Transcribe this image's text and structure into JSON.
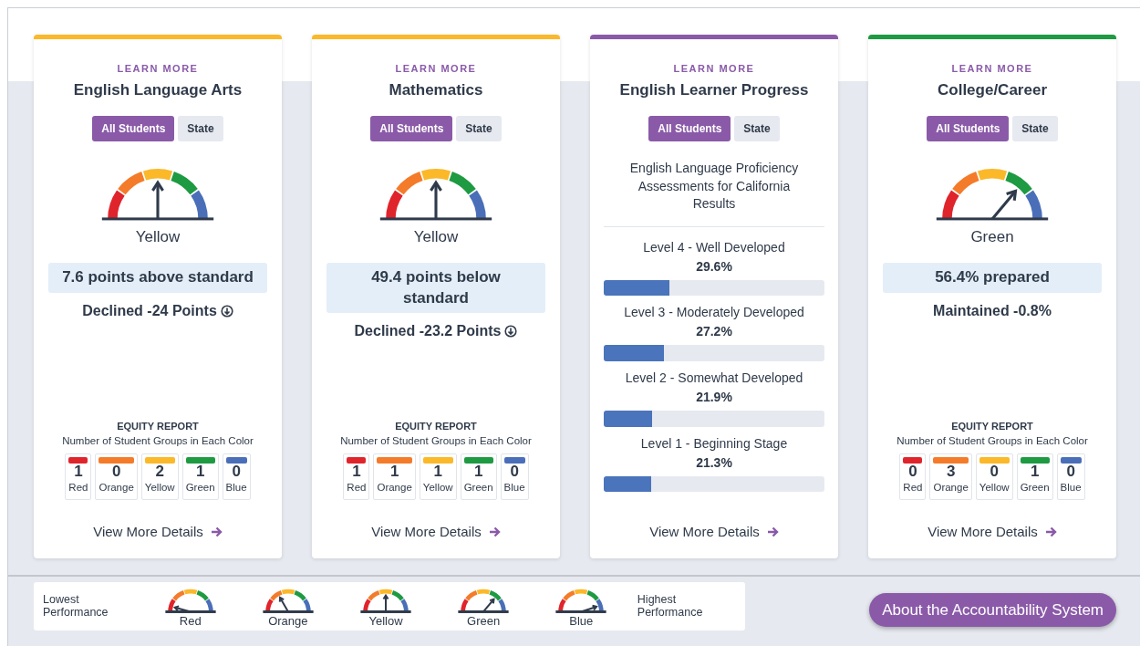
{
  "cards": [
    {
      "color": "#fbb829",
      "link": "LEARN MORE",
      "title": "English Language Arts",
      "toggles": [
        {
          "label": "All Students",
          "selected": true
        },
        {
          "label": "State",
          "selected": false
        }
      ],
      "gauge": {
        "kind": "yellow"
      },
      "status": "Yellow",
      "highlight": "7.6 points above standard",
      "change": "Declined -24 Points",
      "declined_icon": true,
      "equity": {
        "title": "EQUITY REPORT",
        "subtitle": "Number of Student Groups in Each Color",
        "groups": [
          {
            "color": "#e0242b",
            "count": "1",
            "label": "Red"
          },
          {
            "color": "#f47b2a",
            "count": "0",
            "label": "Orange"
          },
          {
            "color": "#fbb829",
            "count": "2",
            "label": "Yellow"
          },
          {
            "color": "#1e9a42",
            "count": "1",
            "label": "Green"
          },
          {
            "color": "#4a6fb8",
            "count": "0",
            "label": "Blue"
          }
        ]
      },
      "details": "View More Details"
    },
    {
      "color": "#fbb829",
      "link": "LEARN MORE",
      "title": "Mathematics",
      "toggles": [
        {
          "label": "All Students",
          "selected": true
        },
        {
          "label": "State",
          "selected": false
        }
      ],
      "gauge": {
        "kind": "yellow"
      },
      "status": "Yellow",
      "highlight": "49.4 points below standard",
      "change": "Declined -23.2 Points",
      "declined_icon": true,
      "equity": {
        "title": "EQUITY REPORT",
        "subtitle": "Number of Student Groups in Each Color",
        "groups": [
          {
            "color": "#e0242b",
            "count": "1",
            "label": "Red"
          },
          {
            "color": "#f47b2a",
            "count": "1",
            "label": "Orange"
          },
          {
            "color": "#fbb829",
            "count": "1",
            "label": "Yellow"
          },
          {
            "color": "#1e9a42",
            "count": "1",
            "label": "Green"
          },
          {
            "color": "#4a6fb8",
            "count": "0",
            "label": "Blue"
          }
        ]
      },
      "details": "View More Details"
    },
    {
      "color": "#8a5aa8",
      "link": "LEARN MORE",
      "title": "English Learner Progress",
      "toggles": [
        {
          "label": "All Students",
          "selected": true
        },
        {
          "label": "State",
          "selected": false
        }
      ],
      "description": "English Language Proficiency Assessments for California Results",
      "levels": [
        {
          "label": "Level 4 - Well Developed",
          "value": "29.6%",
          "level": 0.296
        },
        {
          "label": "Level 3 - Moderately Developed",
          "value": "27.2%",
          "level": 0.272
        },
        {
          "label": "Level 2 - Somewhat Developed",
          "value": "21.9%",
          "level": 0.219
        },
        {
          "label": "Level 1 - Beginning Stage",
          "value": "21.3%",
          "level": 0.213
        }
      ],
      "details": "View More Details"
    },
    {
      "color": "#1e9a42",
      "link": "LEARN MORE",
      "title": "College/Career",
      "toggles": [
        {
          "label": "All Students",
          "selected": true
        },
        {
          "label": "State",
          "selected": false
        }
      ],
      "gauge": {
        "kind": "green"
      },
      "status": "Green",
      "highlight": "56.4% prepared",
      "change": "Maintained -0.8%",
      "equity": {
        "title": "EQUITY REPORT",
        "subtitle": "Number of Student Groups in Each Color",
        "groups": [
          {
            "color": "#e0242b",
            "count": "0",
            "label": "Red"
          },
          {
            "color": "#f47b2a",
            "count": "3",
            "label": "Orange"
          },
          {
            "color": "#fbb829",
            "count": "0",
            "label": "Yellow"
          },
          {
            "color": "#1e9a42",
            "count": "1",
            "label": "Green"
          },
          {
            "color": "#4a6fb8",
            "count": "0",
            "label": "Blue"
          }
        ]
      },
      "details": "View More Details"
    }
  ],
  "legend": {
    "lowest": "Lowest Performance",
    "highest": "Highest Performance",
    "gauges": [
      {
        "gauge": {
          "kind": "red"
        },
        "label": "Red"
      },
      {
        "gauge": {
          "kind": "orange"
        },
        "label": "Orange"
      },
      {
        "gauge": {
          "kind": "yellow"
        },
        "label": "Yellow"
      },
      {
        "gauge": {
          "kind": "green"
        },
        "label": "Green"
      },
      {
        "gauge": {
          "kind": "blue"
        },
        "label": "Blue"
      }
    ]
  },
  "about_button": "About the Accountability System"
}
